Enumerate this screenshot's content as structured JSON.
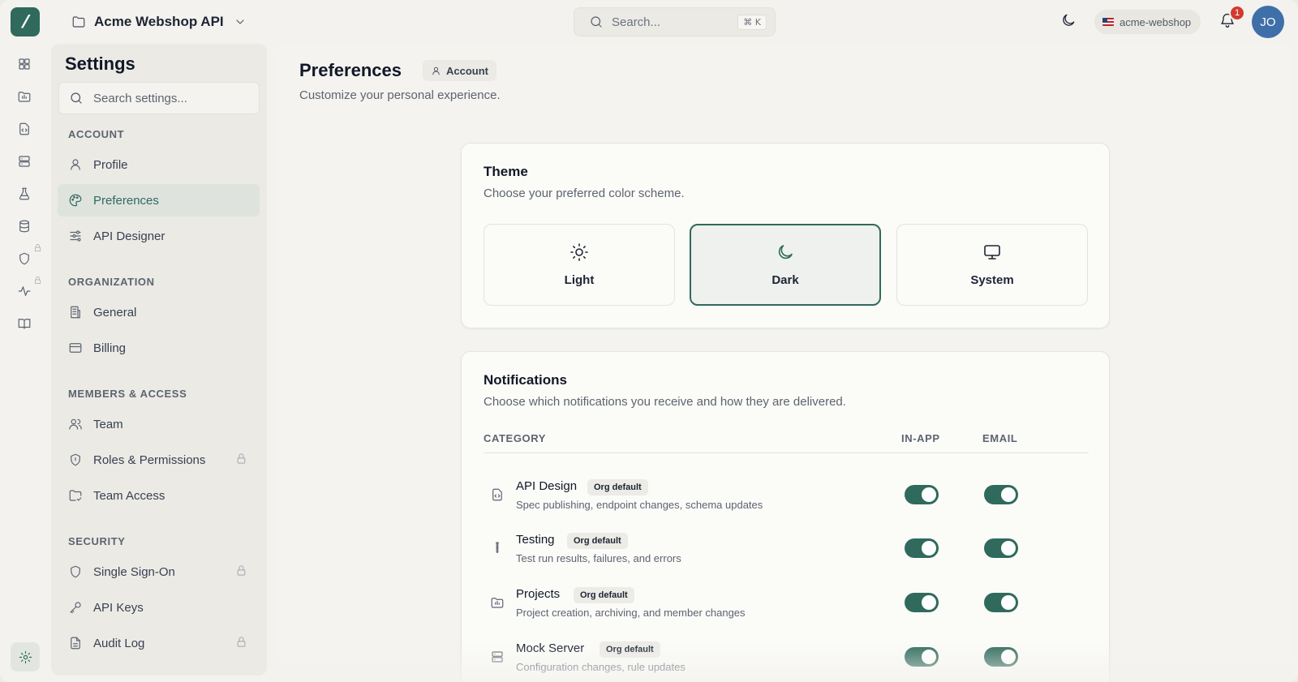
{
  "topbar": {
    "project_name": "Acme Webshop API",
    "search_placeholder": "Search...",
    "search_shortcut": "⌘ K",
    "workspace": "acme-webshop",
    "notification_count": "1",
    "user_initials": "JO",
    "accent_color": "#2f6a5c"
  },
  "rail": {
    "icons": [
      "dashboard-icon",
      "projects-icon",
      "api-design-icon",
      "mock-server-icon",
      "testing-icon",
      "database-icon",
      "security-icon",
      "monitoring-icon",
      "docs-icon",
      "settings-icon"
    ]
  },
  "sidebar": {
    "title": "Settings",
    "search_placeholder": "Search settings...",
    "sections": [
      {
        "label": "ACCOUNT",
        "items": [
          "Profile",
          "Preferences",
          "API Designer"
        ]
      },
      {
        "label": "ORGANIZATION",
        "items": [
          "General",
          "Billing"
        ]
      },
      {
        "label": "MEMBERS & ACCESS",
        "items": [
          "Team",
          "Roles & Permissions",
          "Team Access"
        ]
      },
      {
        "label": "SECURITY",
        "items": [
          "Single Sign-On",
          "API Keys",
          "Audit Log"
        ]
      }
    ],
    "active_item": "Preferences"
  },
  "main": {
    "title": "Preferences",
    "scope_badge": "Account",
    "subtitle": "Customize your personal experience.",
    "theme": {
      "title": "Theme",
      "subtitle": "Choose your preferred color scheme.",
      "options": [
        "Light",
        "Dark",
        "System"
      ],
      "selected": "Dark"
    },
    "notifications": {
      "title": "Notifications",
      "subtitle": "Choose which notifications you receive and how they are delivered.",
      "columns": [
        "CATEGORY",
        "IN-APP",
        "EMAIL"
      ],
      "rows": [
        {
          "name": "API Design",
          "badge": "Org default",
          "desc": "Spec publishing, endpoint changes, schema updates",
          "in_app": true,
          "email": true
        },
        {
          "name": "Testing",
          "badge": "Org default",
          "desc": "Test run results, failures, and errors",
          "in_app": true,
          "email": true
        },
        {
          "name": "Projects",
          "badge": "Org default",
          "desc": "Project creation, archiving, and member changes",
          "in_app": true,
          "email": true
        },
        {
          "name": "Mock Server",
          "badge": "Org default",
          "desc": "Configuration changes, rule updates",
          "in_app": true,
          "email": true
        }
      ]
    }
  }
}
